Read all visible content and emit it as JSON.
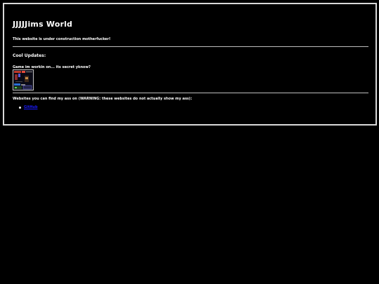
{
  "page": {
    "title": "JJJJJims World",
    "notice": "This website is under construction motherfucker!"
  },
  "updates": {
    "heading": "Cool Updates:",
    "game_caption": "Game im workin on... its secret yknow?",
    "game_thumbnail_icon": "game-screenshot-icon"
  },
  "links": {
    "caption": "Websites you can find my ass on (WARNING: these websites do not actually show my ass):",
    "items": [
      {
        "label": "GitHub"
      }
    ]
  },
  "colors": {
    "background": "#000000",
    "text": "#ffffff",
    "border": "#d9d9d9",
    "link": "#1a1aff"
  }
}
